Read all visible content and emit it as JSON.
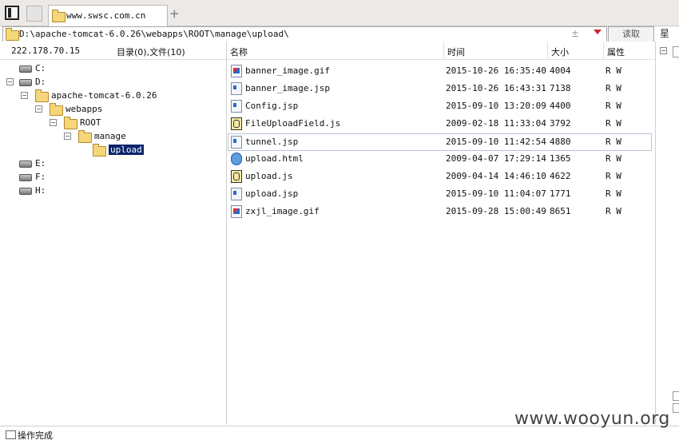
{
  "tabs": {
    "active_label": "www.swsc.com.cn"
  },
  "address": {
    "path": "D:\\apache-tomcat-6.0.26\\webapps\\ROOT\\manage\\upload\\",
    "plusminus": "±",
    "read_button": "读取",
    "side_label": "星"
  },
  "left": {
    "ip": "222.178.70.15",
    "counts": "目录(0),文件(10)",
    "tree": [
      {
        "label": "C:",
        "kind": "drive",
        "depth": 0,
        "expander": ""
      },
      {
        "label": "D:",
        "kind": "drive",
        "depth": 0,
        "expander": "−"
      },
      {
        "label": "apache-tomcat-6.0.26",
        "kind": "folder",
        "depth": 1,
        "expander": "−"
      },
      {
        "label": "webapps",
        "kind": "folder",
        "depth": 2,
        "expander": "−"
      },
      {
        "label": "ROOT",
        "kind": "folder",
        "depth": 3,
        "expander": "−"
      },
      {
        "label": "manage",
        "kind": "folder",
        "depth": 4,
        "expander": "−"
      },
      {
        "label": "upload",
        "kind": "folder",
        "depth": 5,
        "expander": "",
        "selected": true
      },
      {
        "label": "E:",
        "kind": "drive",
        "depth": 0,
        "expander": ""
      },
      {
        "label": "F:",
        "kind": "drive",
        "depth": 0,
        "expander": ""
      },
      {
        "label": "H:",
        "kind": "drive",
        "depth": 0,
        "expander": ""
      }
    ]
  },
  "files": {
    "columns": {
      "name": "名称",
      "time": "时间",
      "size": "大小",
      "attr": "属性"
    },
    "rows": [
      {
        "name": "banner_image.gif",
        "time": "2015-10-26 16:35:40",
        "size": "4004",
        "attr": "R W",
        "icon": "img"
      },
      {
        "name": "banner_image.jsp",
        "time": "2015-10-26 16:43:31",
        "size": "7138",
        "attr": "R W",
        "icon": "jsp"
      },
      {
        "name": "Config.jsp",
        "time": "2015-09-10 13:20:09",
        "size": "4400",
        "attr": "R W",
        "icon": "jsp"
      },
      {
        "name": "FileUploadField.js",
        "time": "2009-02-18 11:33:04",
        "size": "3792",
        "attr": "R W",
        "icon": "js"
      },
      {
        "name": "tunnel.jsp",
        "time": "2015-09-10 11:42:54",
        "size": "4880",
        "attr": "R W",
        "icon": "jsp",
        "focused": true
      },
      {
        "name": "upload.html",
        "time": "2009-04-07 17:29:14",
        "size": "1365",
        "attr": "R W",
        "icon": "html"
      },
      {
        "name": "upload.js",
        "time": "2009-04-14 14:46:10",
        "size": "4622",
        "attr": "R W",
        "icon": "js"
      },
      {
        "name": "upload.jsp",
        "time": "2015-09-10 11:04:07",
        "size": "1771",
        "attr": "R W",
        "icon": "jsp"
      },
      {
        "name": "zxjl_image.gif",
        "time": "2015-09-28 15:00:49",
        "size": "8651",
        "attr": "R W",
        "icon": "img"
      }
    ]
  },
  "right_panel": {
    "expander": "−"
  },
  "status": {
    "text": "操作完成"
  },
  "watermark": "www.wooyun.org"
}
